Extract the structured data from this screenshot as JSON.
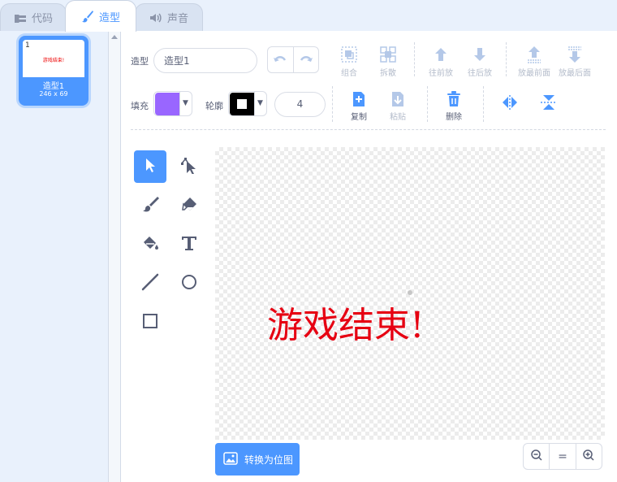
{
  "tabs": [
    {
      "label": "代码",
      "icon": "code-icon",
      "active": false
    },
    {
      "label": "造型",
      "icon": "brush-icon",
      "active": true
    },
    {
      "label": "声音",
      "icon": "speaker-icon",
      "active": false
    }
  ],
  "costume": {
    "index": "1",
    "name": "造型1",
    "size": "246 x 69",
    "preview_text": "游戏结束!"
  },
  "toolbar": {
    "costume_label": "造型",
    "costume_name": "造型1",
    "fill_label": "填充",
    "outline_label": "轮廓",
    "fill_color": "#9966ff",
    "outline_color": "#000000",
    "stroke_width": "4",
    "group_label": "组合",
    "ungroup_label": "拆散",
    "forward_label": "往前放",
    "backward_label": "往后放",
    "front_label": "放最前面",
    "back_label": "放最后面",
    "copy_label": "复制",
    "paste_label": "粘贴",
    "delete_label": "删除"
  },
  "canvas": {
    "text": "游戏结束!",
    "text_color": "#e60012"
  },
  "convert_button": "转换为位图",
  "zoom": {
    "reset_label": "="
  },
  "colors": {
    "accent": "#4c97ff"
  }
}
